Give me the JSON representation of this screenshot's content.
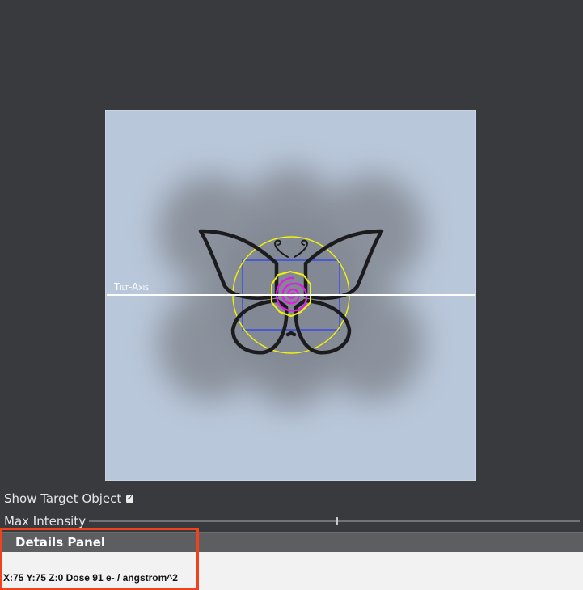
{
  "viewer": {
    "axis_label": "Tilt-Axis"
  },
  "controls": {
    "show_target_label": "Show Target Object",
    "show_target_checked": true,
    "max_intensity_label": "Max Intensity",
    "max_intensity_value": 0.5
  },
  "details": {
    "header": "Details Panel",
    "status": "X:75 Y:75 Z:0 Dose 91 e- / angstrom^2"
  },
  "colors": {
    "background": "#383a3e",
    "highlight": "#f0421c",
    "target_circle": "#f2f20a",
    "target_spiral": "#e020e0",
    "target_rect": "#4a5ad0"
  },
  "icons": {
    "checkbox": "checkbox-checked-icon"
  }
}
